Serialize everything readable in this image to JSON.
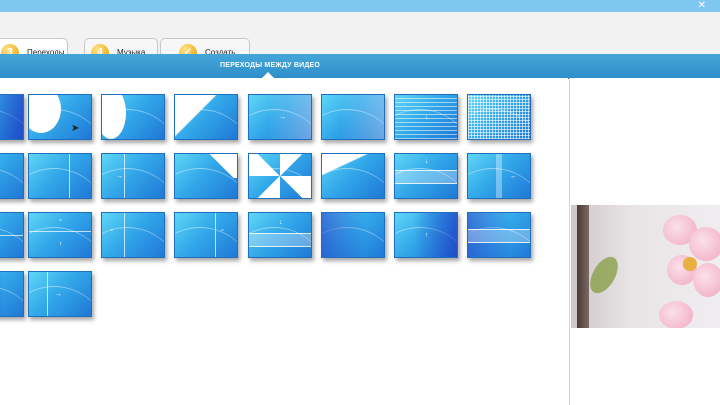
{
  "window": {
    "close_glyph": "✕"
  },
  "tabs": [
    {
      "number": "3",
      "label": "Переходы",
      "active": true
    },
    {
      "number": "4",
      "label": "Музыка",
      "active": false
    },
    {
      "icon": "check-icon",
      "label": "Создать",
      "active": false
    }
  ],
  "header": {
    "title": "ПЕРЕХОДЫ МЕЖДУ ВИДЕО"
  },
  "colors": {
    "header": "#2f8fca",
    "tile": "#33a9ea",
    "tab_badge": "#f0b020"
  },
  "transitions": {
    "row1": [
      "blob-wipe",
      "circle-wipe",
      "diagonal-wipe",
      "slide-fade",
      "fade",
      "stripes",
      "grid-dissolve"
    ],
    "row2": [
      "vertical-split",
      "slide",
      "corner-peel",
      "pinwheel",
      "diagonal-slide",
      "horizontal-band",
      "vertical-band"
    ],
    "row3": [
      "split-frame",
      "double-slide",
      "frame-slide",
      "down-slide",
      "dark-wipe",
      "dark-slide",
      "dark-fade"
    ],
    "row4": [
      "dotted-wipe"
    ]
  }
}
